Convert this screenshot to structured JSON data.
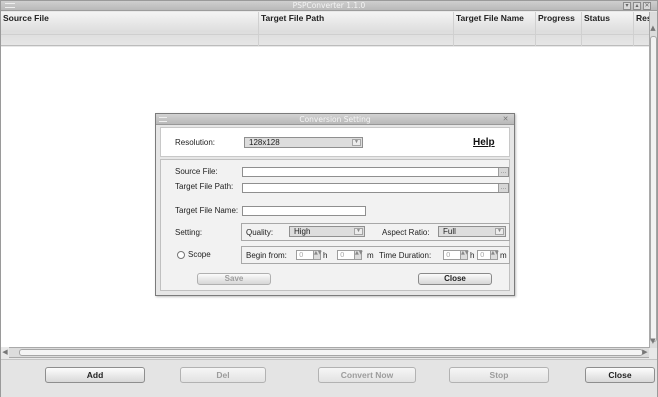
{
  "window": {
    "title": "PSPConverter 1.1.0"
  },
  "table": {
    "columns": [
      "Source File",
      "Target File Path",
      "Target File Name",
      "Progress",
      "Status",
      "Res"
    ],
    "rows": []
  },
  "toolbar": {
    "add": "Add",
    "del": "Del",
    "convert": "Convert Now",
    "stop": "Stop",
    "close": "Close"
  },
  "dialog": {
    "title": "Conversion Setting",
    "resolution_label": "Resolution:",
    "resolution_value": "128x128",
    "help": "Help",
    "source_label": "Source File:",
    "target_path_label": "Target File Path:",
    "target_name_label": "Target File Name:",
    "setting_label": "Setting:",
    "quality_label": "Quality:",
    "quality_value": "High",
    "aspect_label": "Aspect Ratio:",
    "aspect_value": "Full",
    "scope_label": "Scope",
    "begin_label": "Begin from:",
    "begin_h": "0",
    "h_unit": "h",
    "begin_m": "0",
    "m_unit": "m",
    "duration_label": "Time Duration:",
    "duration_h": "0",
    "duration_m": "0",
    "save": "Save",
    "close": "Close"
  }
}
